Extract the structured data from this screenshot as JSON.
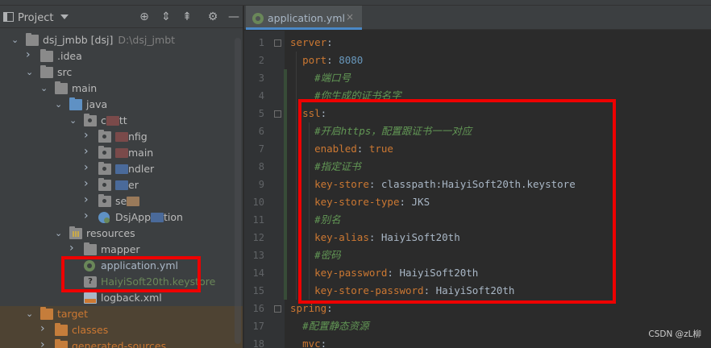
{
  "project_panel": {
    "title": "Project",
    "toolbar": [
      "locate-icon",
      "expand-all-icon",
      "collapse-all-icon",
      "gear-icon",
      "minimize-icon"
    ],
    "tree": [
      {
        "depth": 0,
        "arrow": "open",
        "icon": "module",
        "label": "dsj_jmbb [dsj]",
        "hint": "D:\\dsj_jmbt"
      },
      {
        "depth": 1,
        "arrow": "closed",
        "icon": "folder",
        "label": ".idea"
      },
      {
        "depth": 1,
        "arrow": "open",
        "icon": "folder",
        "label": "src"
      },
      {
        "depth": 2,
        "arrow": "open",
        "icon": "folder",
        "label": "main"
      },
      {
        "depth": 3,
        "arrow": "open",
        "icon": "folder-blue",
        "label": "java"
      },
      {
        "depth": 4,
        "arrow": "open",
        "icon": "package",
        "label": "c",
        "blurred": "a",
        "tail": "tt"
      },
      {
        "depth": 5,
        "arrow": "closed",
        "icon": "package",
        "label": "nfig",
        "blurred_prefix": "a"
      },
      {
        "depth": 5,
        "arrow": "closed",
        "icon": "package",
        "label": "main",
        "blurred_prefix": "a"
      },
      {
        "depth": 5,
        "arrow": "closed",
        "icon": "package",
        "label": "ndler",
        "blurred_prefix": "b"
      },
      {
        "depth": 5,
        "arrow": "closed",
        "icon": "package",
        "label": "er",
        "blurred_prefix": "b"
      },
      {
        "depth": 5,
        "arrow": "closed",
        "icon": "package",
        "label": "se",
        "blurred": "c"
      },
      {
        "depth": 5,
        "arrow": "closed",
        "icon": "spring-class",
        "label": "DsjApp",
        "blurred": "b",
        "tail": "tion"
      },
      {
        "depth": 3,
        "arrow": "open",
        "icon": "folder-resources",
        "label": "resources"
      },
      {
        "depth": 4,
        "arrow": "closed",
        "icon": "folder",
        "label": "mapper"
      },
      {
        "depth": 4,
        "arrow": "none",
        "icon": "yml",
        "label": "application.yml",
        "color": "#a9b7c6"
      },
      {
        "depth": 4,
        "arrow": "none",
        "icon": "keystore",
        "label": "HaiyiSoft20th.keystore",
        "color": "#6a8759"
      },
      {
        "depth": 4,
        "arrow": "none",
        "icon": "xml",
        "label": "logback.xml"
      },
      {
        "depth": 1,
        "arrow": "open",
        "icon": "folder-orange",
        "label": "target",
        "color": "#cc7832",
        "highlight": true
      },
      {
        "depth": 2,
        "arrow": "closed",
        "icon": "folder-orange",
        "label": "classes",
        "color": "#cc7832",
        "highlight": true
      },
      {
        "depth": 2,
        "arrow": "closed",
        "icon": "folder-orange",
        "label": "generated-sources",
        "color": "#cc7832",
        "highlight": true
      }
    ]
  },
  "editor": {
    "tab_label": "application.yml",
    "tab_close": "×",
    "lines": [
      {
        "n": "1",
        "segs": [
          [
            "k",
            "server"
          ],
          [
            "v",
            ":"
          ]
        ]
      },
      {
        "n": "2",
        "segs": [
          [
            "v",
            "  "
          ],
          [
            "k",
            "port"
          ],
          [
            "v",
            ": "
          ],
          [
            "n",
            "8080"
          ]
        ]
      },
      {
        "n": "3",
        "segs": [
          [
            "v",
            "    "
          ],
          [
            "cm",
            "#端口号"
          ]
        ]
      },
      {
        "n": "4",
        "segs": [
          [
            "v",
            "    "
          ],
          [
            "cm",
            "#你生成的证书名字"
          ]
        ]
      },
      {
        "n": "5",
        "segs": [
          [
            "v",
            "  "
          ],
          [
            "k",
            "ssl"
          ],
          [
            "v",
            ":"
          ]
        ]
      },
      {
        "n": "6",
        "segs": [
          [
            "v",
            "    "
          ],
          [
            "cm",
            "#开启https，配置跟证书一一对应"
          ]
        ]
      },
      {
        "n": "7",
        "segs": [
          [
            "v",
            "    "
          ],
          [
            "k",
            "enabled"
          ],
          [
            "v",
            ": "
          ],
          [
            "bool",
            "true"
          ]
        ]
      },
      {
        "n": "8",
        "segs": [
          [
            "v",
            "    "
          ],
          [
            "cm",
            "#指定证书"
          ]
        ]
      },
      {
        "n": "9",
        "segs": [
          [
            "v",
            "    "
          ],
          [
            "k",
            "key-store"
          ],
          [
            "v",
            ": classpath:HaiyiSoft20th.keystore"
          ]
        ]
      },
      {
        "n": "10",
        "segs": [
          [
            "v",
            "    "
          ],
          [
            "k",
            "key-store-type"
          ],
          [
            "v",
            ": JKS"
          ]
        ]
      },
      {
        "n": "11",
        "segs": [
          [
            "v",
            "    "
          ],
          [
            "cm",
            "#别名"
          ]
        ]
      },
      {
        "n": "12",
        "segs": [
          [
            "v",
            "    "
          ],
          [
            "k",
            "key-alias"
          ],
          [
            "v",
            ": HaiyiSoft20th"
          ]
        ]
      },
      {
        "n": "13",
        "segs": [
          [
            "v",
            "    "
          ],
          [
            "cm",
            "#密码"
          ]
        ]
      },
      {
        "n": "14",
        "segs": [
          [
            "v",
            "    "
          ],
          [
            "k",
            "key-password"
          ],
          [
            "v",
            ": HaiyiSoft20th"
          ]
        ]
      },
      {
        "n": "15",
        "segs": [
          [
            "v",
            "    "
          ],
          [
            "k",
            "key-store-password"
          ],
          [
            "v",
            ": HaiyiSoft20th"
          ]
        ]
      },
      {
        "n": "16",
        "segs": [
          [
            "k",
            "spring"
          ],
          [
            "v",
            ":"
          ]
        ]
      },
      {
        "n": "17",
        "segs": [
          [
            "v",
            "  "
          ],
          [
            "cm",
            "#配置静态资源"
          ]
        ]
      },
      {
        "n": "18",
        "segs": [
          [
            "v",
            "  "
          ],
          [
            "k",
            "mvc"
          ],
          [
            "v",
            ":"
          ]
        ]
      }
    ]
  },
  "watermark": "CSDN @zL柳",
  "colors": {
    "annotation_red": "#ee0000",
    "keyword": "#cc7832",
    "comment": "#629755",
    "number": "#6897bb",
    "text": "#a9b7c6"
  }
}
